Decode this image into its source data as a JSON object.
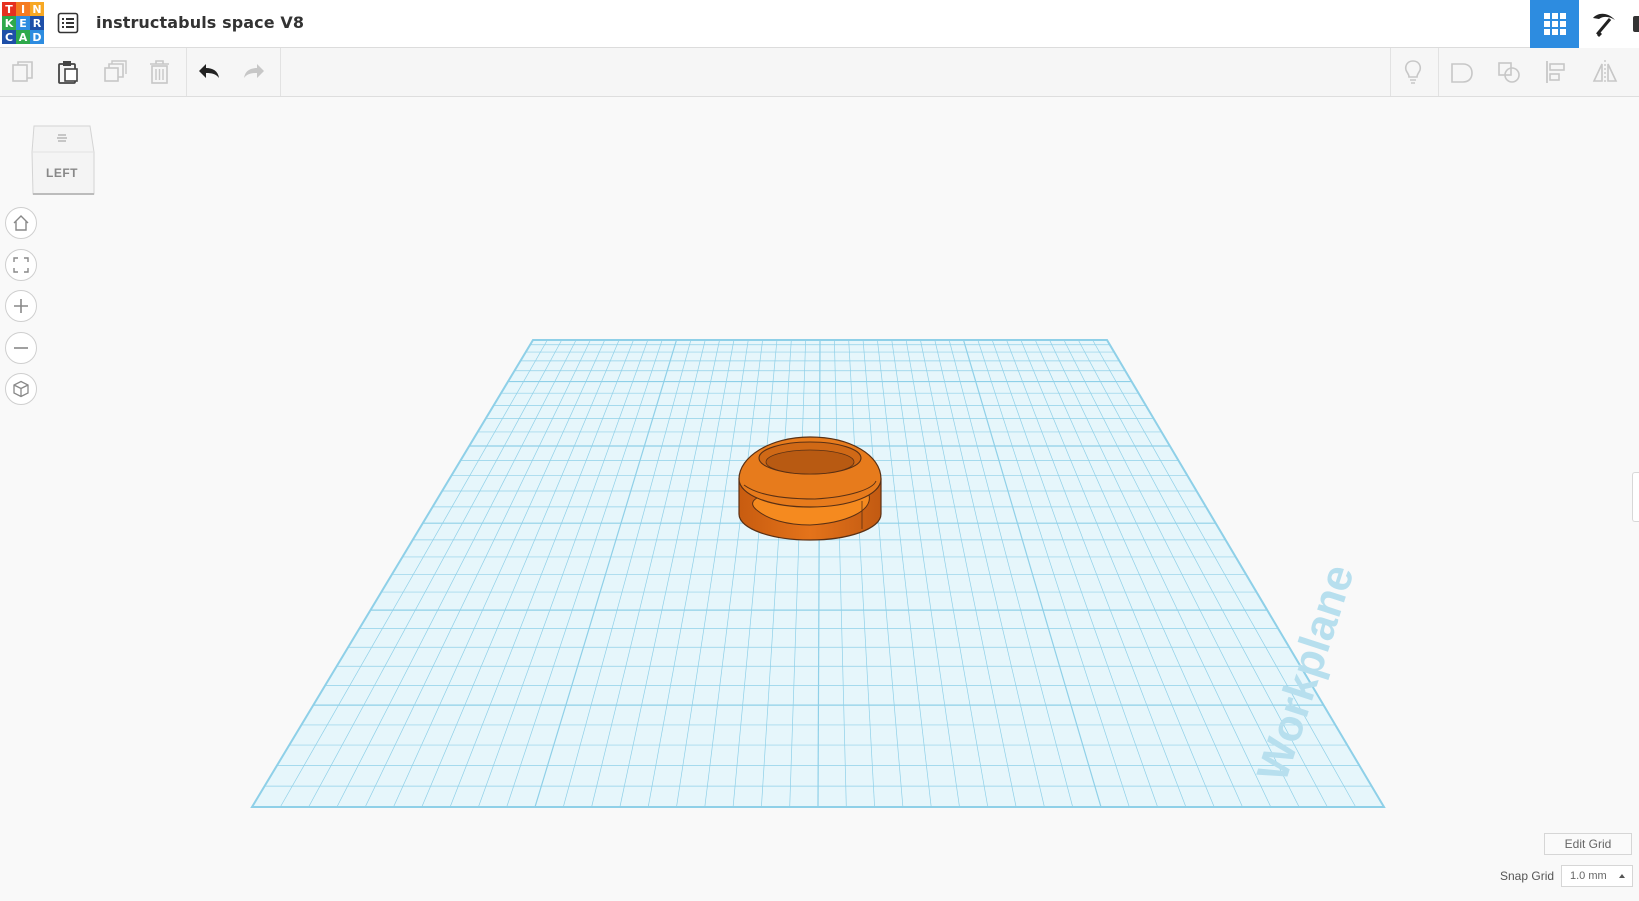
{
  "app": {
    "logo_letters": [
      "T",
      "I",
      "N",
      "K",
      "E",
      "R",
      "C",
      "A",
      "D"
    ],
    "logo_colors": [
      "#e6301f",
      "#f57b20",
      "#f7a823",
      "#2ea94b",
      "#2d8ce0",
      "#1e4fa8",
      "#1e4fa8",
      "#2ea94b",
      "#2d8ce0"
    ],
    "title": "instructabuls space V8"
  },
  "header": {
    "views": [
      {
        "name": "3D design",
        "icon": "grid-icon",
        "active": true
      },
      {
        "name": "Blocks",
        "icon": "pickaxe-icon",
        "active": false
      }
    ]
  },
  "toolbar": {
    "left": [
      {
        "name": "copy",
        "icon": "copy-icon",
        "enabled": false
      },
      {
        "name": "paste",
        "icon": "paste-icon",
        "enabled": true
      },
      {
        "name": "duplicate",
        "icon": "duplicate-icon",
        "enabled": false
      },
      {
        "name": "delete",
        "icon": "trash-icon",
        "enabled": false
      },
      {
        "name": "undo",
        "icon": "undo-icon",
        "enabled": true
      },
      {
        "name": "redo",
        "icon": "redo-icon",
        "enabled": false
      }
    ],
    "right": [
      {
        "name": "show all",
        "icon": "lightbulb-icon",
        "enabled": false
      },
      {
        "name": "group",
        "icon": "group-icon",
        "enabled": false
      },
      {
        "name": "ungroup",
        "icon": "ungroup-icon",
        "enabled": false
      },
      {
        "name": "align",
        "icon": "align-icon",
        "enabled": false
      },
      {
        "name": "mirror",
        "icon": "mirror-icon",
        "enabled": false
      }
    ]
  },
  "view_cube": {
    "label": "LEFT"
  },
  "nav_controls": [
    {
      "name": "home",
      "icon": "home-icon"
    },
    {
      "name": "fit",
      "icon": "fit-icon"
    },
    {
      "name": "zoom in",
      "icon": "plus-icon"
    },
    {
      "name": "zoom out",
      "icon": "minus-icon"
    },
    {
      "name": "perspective",
      "icon": "cube-icon"
    }
  ],
  "workplane": {
    "label": "Workplane",
    "grid_color": "#8fd0e8",
    "shape_color": "#f07c1f"
  },
  "grid_controls": {
    "edit_grid_label": "Edit Grid",
    "snap_grid_label": "Snap Grid",
    "snap_grid_value": "1.0 mm"
  }
}
